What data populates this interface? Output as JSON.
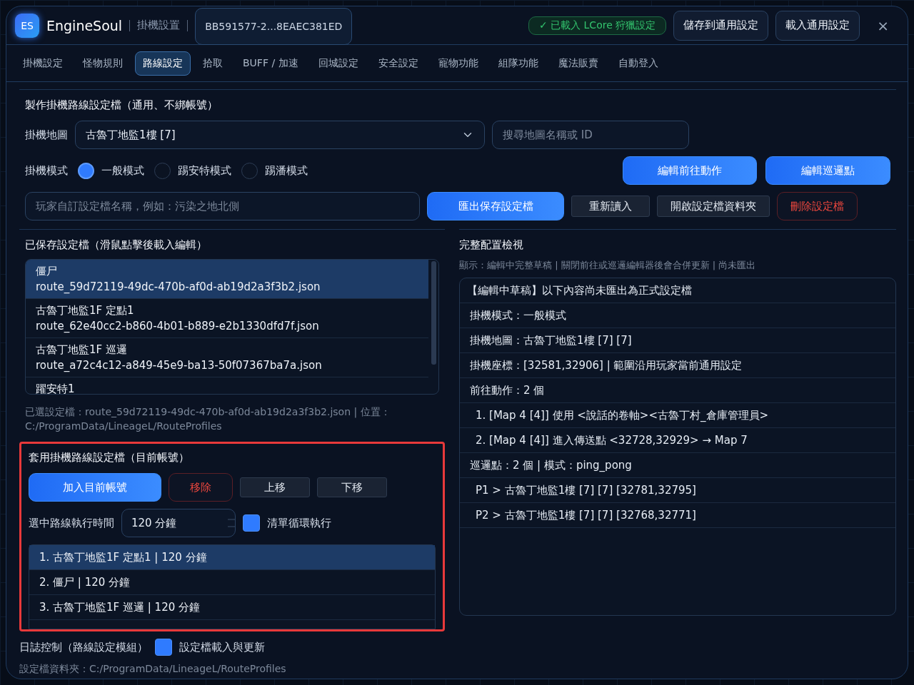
{
  "header": {
    "logo": "ES",
    "app_name": "EngineSoul",
    "section": "掛機設置",
    "device_id": "BB591577-2...8EAEC381ED",
    "status_badge": "✓ 已載入 LCore 狩獵設定",
    "buttons": [
      "儲存到通用設定",
      "載入通用設定"
    ],
    "close": "×"
  },
  "tabs": [
    {
      "label": "掛機設定",
      "selected": false
    },
    {
      "label": "怪物規則",
      "selected": false
    },
    {
      "label": "路線設定",
      "selected": true
    },
    {
      "label": "拾取",
      "selected": false
    },
    {
      "label": "BUFF / 加速",
      "selected": false
    },
    {
      "label": "回城設定",
      "selected": false
    },
    {
      "label": "安全設定",
      "selected": false
    },
    {
      "label": "寵物功能",
      "selected": false
    },
    {
      "label": "組隊功能",
      "selected": false
    },
    {
      "label": "魔法販賣",
      "selected": false
    },
    {
      "label": "自動登入",
      "selected": false
    }
  ],
  "create_section": {
    "title": "製作掛機路線設定檔（通用、不綁帳號）",
    "map_label": "掛機地圖",
    "map_value": "古魯丁地監1樓 [7]",
    "map_search": {
      "placeholder": "搜尋地圖名稱或 ID"
    },
    "mode_label": "掛機模式",
    "modes": [
      {
        "label": "一般模式",
        "selected": true
      },
      {
        "label": "踢安特模式",
        "selected": false
      },
      {
        "label": "踢潘模式",
        "selected": false
      }
    ],
    "edit_buttons": [
      "編輯前往動作",
      "編輯巡邏點"
    ],
    "name_field": {
      "placeholder": "玩家自訂設定檔名稱，例如：污染之地北側"
    },
    "actions": [
      {
        "label": "匯出保存設定檔",
        "kind": "primary"
      },
      {
        "label": "重新讀入",
        "kind": "plain"
      },
      {
        "label": "開啟設定檔資料夾",
        "kind": "plain"
      },
      {
        "label": "刪除設定檔",
        "kind": "danger"
      }
    ]
  },
  "saved_section": {
    "title": "已保存設定檔（滑鼠點擊後載入編輯）",
    "files": [
      {
        "name": "僵尸",
        "file": "route_59d72119-49dc-470b-af0d-ab19d2a3f3b2.json",
        "selected": true
      },
      {
        "name": "古魯丁地監1F 定點1",
        "file": "route_62e40cc2-b860-4b01-b889-e2b1330dfd7f.json",
        "selected": false
      },
      {
        "name": "古魯丁地監1F 巡邏",
        "file": "route_a72c4c12-a849-45e9-ba13-50f07367ba7a.json",
        "selected": false
      },
      {
        "name": "躍安特1",
        "selected": false
      }
    ],
    "status": "已選設定檔：route_59d72119-49dc-470b-af0d-ab19d2a3f3b2.json | 位置：C:/ProgramData/LineageL/RouteProfiles"
  },
  "apply_section": {
    "title": "套用掛機路線設定檔（目前帳號）",
    "actions": [
      {
        "label": "加入目前帳號",
        "kind": "primary"
      },
      {
        "label": "移除",
        "kind": "danger"
      },
      {
        "label": "上移",
        "kind": "plain"
      },
      {
        "label": "下移",
        "kind": "plain"
      }
    ],
    "duration_label": "選中路線執行時間",
    "duration_value": "120 分鐘",
    "loop": {
      "label": "清單循環執行",
      "checked": true
    },
    "queue": [
      {
        "text": "1. 古魯丁地監1F 定點1 | 120 分鐘",
        "selected": true
      },
      {
        "text": "2. 僵尸 | 120 分鐘",
        "selected": false
      },
      {
        "text": "3. 古魯丁地監1F 巡邏 | 120 分鐘",
        "selected": false
      }
    ]
  },
  "log_control": {
    "label": "日誌控制（路線設定模組）",
    "option": {
      "label": "設定檔載入與更新",
      "checked": true
    }
  },
  "folder_path": "設定檔資料夾：C:/ProgramData/LineageL/RouteProfiles",
  "preview": {
    "title": "完整配置檢視",
    "hint": "顯示：編輯中完整草稿 | 關閉前往或巡邏編輯器後會合併更新 | 尚未匯出",
    "lines": [
      {
        "text": "【編輯中草稿】以下內容尚未匯出為正式設定檔",
        "kind": "head"
      },
      {
        "text": "掛機模式：一般模式",
        "kind": "item"
      },
      {
        "text": "掛機地圖：古魯丁地監1樓 [7] [7]",
        "kind": "item"
      },
      {
        "text": "掛機座標：[32581,32906] | 範圍沿用玩家當前通用設定",
        "kind": "item"
      },
      {
        "text": "前往動作：2 個",
        "kind": "item"
      },
      {
        "text": "1. [Map 4 [4]] 使用 <說話的卷軸><古魯丁村_倉庫管理員>",
        "kind": "sub"
      },
      {
        "text": "2. [Map 4 [4]] 進入傳送點 <32728,32929> → Map 7",
        "kind": "sub"
      },
      {
        "text": "巡邏點：2 個 | 模式：ping_pong",
        "kind": "item"
      },
      {
        "text": "P1 > 古魯丁地監1樓 [7] [7] [32781,32795]",
        "kind": "sub"
      },
      {
        "text": "P2 > 古魯丁地監1樓 [7] [7] [32768,32771]",
        "kind": "sub"
      }
    ]
  }
}
